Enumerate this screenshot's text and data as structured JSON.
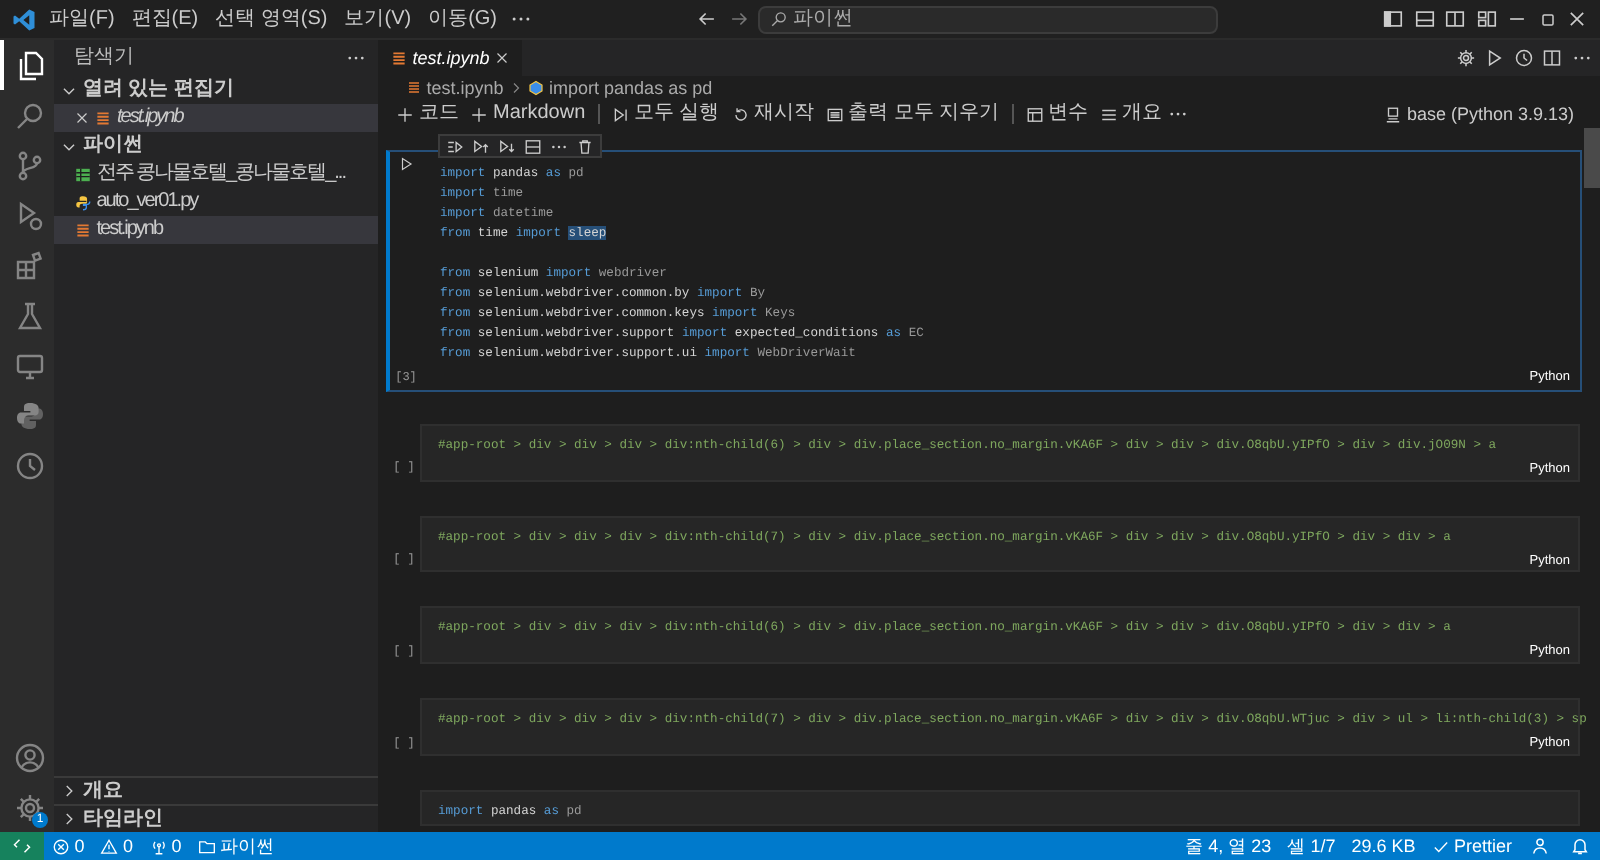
{
  "title_bar": {
    "menus": [
      {
        "label": "파일(F)"
      },
      {
        "label": "편집(E)"
      },
      {
        "label": "선택 영역(S)"
      },
      {
        "label": "보기(V)"
      },
      {
        "label": "이동(G)"
      }
    ],
    "command_center": "파이썬"
  },
  "activity_bar": {
    "items": [
      {
        "kind": "explorer",
        "selected": true
      },
      {
        "kind": "search",
        "selected": false
      },
      {
        "kind": "source-control",
        "selected": false
      },
      {
        "kind": "run-debug",
        "selected": false
      },
      {
        "kind": "extensions",
        "selected": false
      },
      {
        "kind": "testing",
        "selected": false
      },
      {
        "kind": "remote",
        "selected": false
      },
      {
        "kind": "python",
        "selected": false
      },
      {
        "kind": "history",
        "selected": false
      }
    ],
    "settings_badge": "1"
  },
  "sidebar": {
    "title": "탐색기",
    "sections": [
      {
        "kind": "open-editors",
        "title": "열려 있는 편집기",
        "expanded": true,
        "items": [
          {
            "kind": "notebook",
            "label": "test.ipynb",
            "selected": true,
            "preview": true
          }
        ]
      },
      {
        "kind": "folder",
        "title": "파이썬",
        "expanded": true,
        "items": [
          {
            "kind": "spreadsheet",
            "label": "전주 콩나물호텔_콩나물호텔_...",
            "selected": false
          },
          {
            "kind": "python",
            "label": "auto_ver01.py",
            "selected": false
          },
          {
            "kind": "notebook",
            "label": "test.ipynb",
            "selected": true
          }
        ]
      }
    ],
    "footer_sections": [
      {
        "title": "개요",
        "expanded": false
      },
      {
        "title": "타임라인",
        "expanded": false
      }
    ]
  },
  "editor": {
    "tabs": [
      {
        "label": "test.ipynb",
        "selected": true,
        "preview": true
      }
    ],
    "breadcrumb": [
      "test.ipynb",
      "import pandas as pd"
    ],
    "toolbar": [
      [
        {
          "kind": "add",
          "label": "코드"
        },
        {
          "kind": "add",
          "label": "Markdown"
        }
      ],
      [
        {
          "kind": "run-all",
          "label": "모두 실행"
        },
        {
          "kind": "restart",
          "label": "재시작"
        },
        {
          "kind": "clear",
          "label": "출력 모두 지우기"
        }
      ],
      [
        {
          "kind": "variables",
          "label": "변수"
        },
        {
          "kind": "outline",
          "label": "개요"
        },
        {
          "kind": "more"
        }
      ]
    ],
    "kernel": "base (Python 3.9.13)",
    "cells": [
      {
        "focused": true,
        "execution": "[3]",
        "language": "Python",
        "blocks": [
          [
            [
              {
                "kind": "keyword",
                "text": "import"
              },
              {
                "kind": "name",
                "text": " pandas "
              },
              {
                "kind": "keyword",
                "text": "as"
              },
              {
                "kind": "dim",
                "text": " pd"
              }
            ],
            [
              {
                "kind": "keyword",
                "text": "import"
              },
              {
                "kind": "dim",
                "text": " time"
              }
            ],
            [
              {
                "kind": "keyword",
                "text": "import"
              },
              {
                "kind": "dim",
                "text": " datetime"
              }
            ],
            [
              {
                "kind": "keyword",
                "text": "from"
              },
              {
                "kind": "name",
                "text": " time "
              },
              {
                "kind": "keyword",
                "text": "import "
              },
              {
                "kind": "selection",
                "text": "sleep"
              }
            ]
          ],
          [
            [
              {
                "kind": "keyword",
                "text": "from"
              },
              {
                "kind": "name",
                "text": " selenium "
              },
              {
                "kind": "keyword",
                "text": "import"
              },
              {
                "kind": "dim",
                "text": " webdriver"
              }
            ],
            [
              {
                "kind": "keyword",
                "text": "from"
              },
              {
                "kind": "name",
                "text": " selenium.webdriver.common.by "
              },
              {
                "kind": "keyword",
                "text": "import"
              },
              {
                "kind": "dim",
                "text": " By"
              }
            ],
            [
              {
                "kind": "keyword",
                "text": "from"
              },
              {
                "kind": "name",
                "text": " selenium.webdriver.common.keys "
              },
              {
                "kind": "keyword",
                "text": "import"
              },
              {
                "kind": "dim",
                "text": " Keys"
              }
            ],
            [
              {
                "kind": "keyword",
                "text": "from"
              },
              {
                "kind": "name",
                "text": " selenium.webdriver.support "
              },
              {
                "kind": "keyword",
                "text": "import"
              },
              {
                "kind": "name",
                "text": " expected_conditions "
              },
              {
                "kind": "keyword",
                "text": "as"
              },
              {
                "kind": "dim",
                "text": " EC"
              }
            ],
            [
              {
                "kind": "keyword",
                "text": "from"
              },
              {
                "kind": "name",
                "text": " selenium.webdriver.support.ui "
              },
              {
                "kind": "keyword",
                "text": "import"
              },
              {
                "kind": "dim",
                "text": " WebDriverWait"
              }
            ]
          ]
        ]
      },
      {
        "focused": false,
        "execution": "[ ]",
        "language": "Python",
        "blocks": [
          [
            [
              {
                "kind": "string",
                "text": "#app-root > div > div > div > div:nth-child(6) > div > div.place_section.no_margin.vKA6F > div > div > div.O8qbU.yIPfO > div > div.jO09N > a"
              }
            ]
          ]
        ]
      },
      {
        "focused": false,
        "execution": "[ ]",
        "language": "Python",
        "blocks": [
          [
            [
              {
                "kind": "string",
                "text": "#app-root > div > div > div > div:nth-child(7) > div > div.place_section.no_margin.vKA6F > div > div > div.O8qbU.yIPfO > div > div > a"
              }
            ]
          ]
        ]
      },
      {
        "focused": false,
        "execution": "[ ]",
        "language": "Python",
        "blocks": [
          [
            [
              {
                "kind": "string",
                "text": "#app-root > div > div > div > div:nth-child(6) > div > div.place_section.no_margin.vKA6F > div > div > div.O8qbU.yIPfO > div > div > a"
              }
            ]
          ]
        ]
      },
      {
        "focused": false,
        "execution": "[ ]",
        "language": "Python",
        "blocks": [
          [
            [
              {
                "kind": "string",
                "text": "#app-root > div > div > div > div:nth-child(7) > div > div.place_section.no_margin.vKA6F > div > div > div.O8qbU.WTjuc > div > ul > li:nth-child(3) > sp"
              }
            ]
          ]
        ]
      },
      {
        "focused": false,
        "blocks": [
          [
            [
              {
                "kind": "keyword",
                "text": "import"
              },
              {
                "kind": "name",
                "text": " pandas "
              },
              {
                "kind": "keyword",
                "text": "as"
              },
              {
                "kind": "dim",
                "text": " pd"
              }
            ]
          ]
        ]
      }
    ]
  },
  "status_bar": {
    "left": [
      {
        "kind": "remote"
      },
      {
        "kind": "errors",
        "label": "0"
      },
      {
        "kind": "warnings",
        "label": "0"
      },
      {
        "kind": "ports",
        "label": "0"
      },
      {
        "kind": "folder",
        "label": "파이썬"
      }
    ],
    "right": [
      {
        "kind": "text",
        "label": "줄 4, 열 23"
      },
      {
        "kind": "text",
        "label": "셀 1/7"
      },
      {
        "kind": "text",
        "label": "29.6 KB"
      },
      {
        "kind": "check",
        "label": "Prettier"
      },
      {
        "kind": "person"
      },
      {
        "kind": "bell"
      }
    ]
  }
}
